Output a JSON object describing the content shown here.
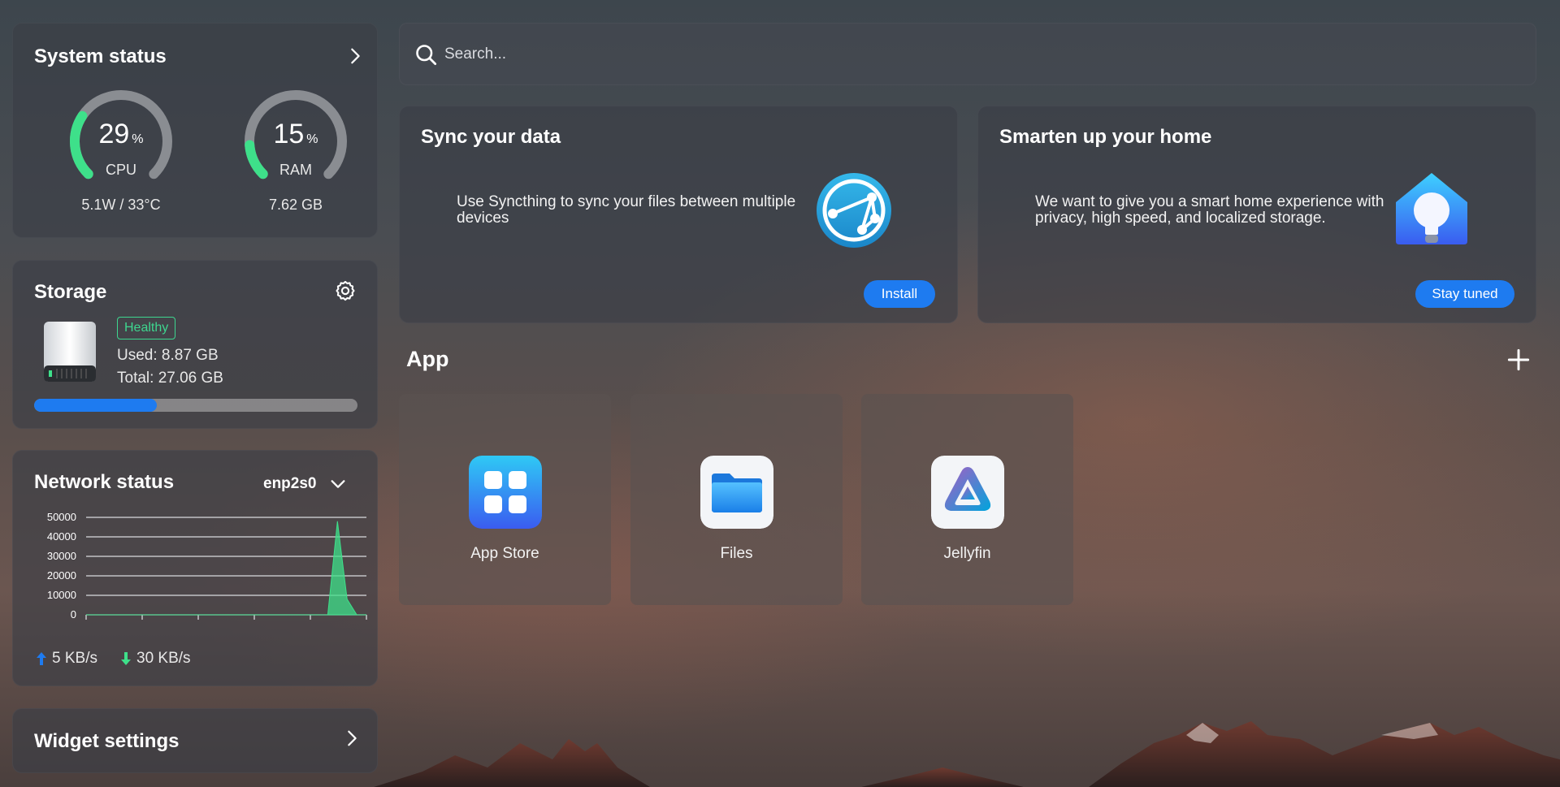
{
  "system_status": {
    "title": "System status",
    "cpu": {
      "value": "29",
      "unit": "%",
      "label": "CPU",
      "sub": "5.1W / 33°C",
      "level": 0.29
    },
    "ram": {
      "value": "15",
      "unit": "%",
      "label": "RAM",
      "sub": "7.62 GB",
      "level": 0.15
    }
  },
  "storage": {
    "title": "Storage",
    "status_badge": "Healthy",
    "used": "Used: 8.87 GB",
    "total": "Total: 27.06 GB",
    "used_fraction": 0.38
  },
  "network": {
    "title": "Network status",
    "interface": "enp2s0",
    "upload": "5 KB/s",
    "download": "30 KB/s"
  },
  "widget_settings": {
    "title": "Widget settings"
  },
  "search": {
    "placeholder": "Search..."
  },
  "promos": [
    {
      "title": "Sync your data",
      "description": "Use Syncthing to sync your files between multiple devices",
      "button": "Install"
    },
    {
      "title": "Smarten up your home",
      "description": "We want to give you a smart home experience with privacy, high speed, and localized storage.",
      "button": "Stay tuned"
    }
  ],
  "apps_section": {
    "title": "App"
  },
  "apps": [
    {
      "name": "App Store",
      "icon": "app-store-icon"
    },
    {
      "name": "Files",
      "icon": "folder-icon"
    },
    {
      "name": "Jellyfin",
      "icon": "jellyfin-icon"
    }
  ],
  "colors": {
    "accent": "#1e7bf0",
    "gauge": "#3ee08a",
    "healthy": "#3ed68f",
    "upload_arrow": "#1e7bf0",
    "download_arrow": "#3ee08a"
  },
  "chart_data": {
    "type": "area",
    "yticks": [
      "50000",
      "40000",
      "30000",
      "20000",
      "10000",
      "0"
    ],
    "ylim": [
      0,
      50000
    ],
    "x": [
      0,
      1,
      2,
      3,
      4,
      5,
      6,
      7,
      8,
      9,
      10,
      11,
      12,
      13,
      14,
      15,
      16,
      17,
      18,
      19,
      20,
      21,
      22,
      23,
      24,
      25,
      26,
      27,
      28,
      29
    ],
    "series": [
      {
        "values": [
          0,
          0,
          0,
          0,
          0,
          0,
          0,
          0,
          0,
          0,
          0,
          0,
          0,
          0,
          0,
          0,
          0,
          0,
          0,
          0,
          0,
          0,
          0,
          0,
          0,
          0,
          48000,
          8000,
          0,
          0
        ]
      }
    ],
    "grid": true
  }
}
